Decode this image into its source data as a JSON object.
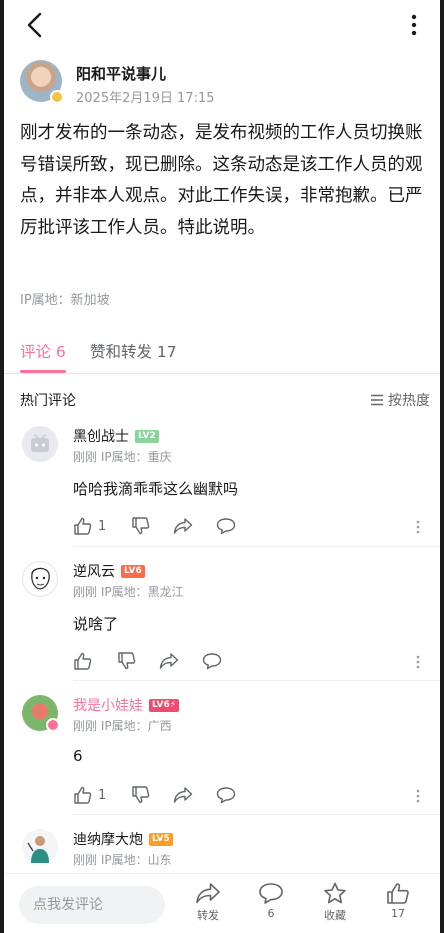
{
  "post": {
    "author_name": "阳和平说事儿",
    "timestamp": "2025年2月19日 17:15",
    "content": "刚才发布的一条动态，是发布视频的工作人员切换账号错误所致，现已删除。这条动态是该工作人员的观点，并非本人观点。对此工作失误，非常抱歉。已严厉批评该工作人员。特此说明。",
    "ip_location": "IP属地：新加坡"
  },
  "tabs": [
    {
      "label": "评论 6",
      "active": true
    },
    {
      "label": "赞和转发 17",
      "active": false
    }
  ],
  "hot": {
    "title": "热门评论",
    "sort_label": "按热度"
  },
  "comments": [
    {
      "name": "黑创战士",
      "level": "LV2",
      "meta": "刚刚  IP属地：重庆",
      "text": "哈哈我滴乖乖这么幽默吗",
      "likes": "1"
    },
    {
      "name": "逆风云",
      "level": "LV6",
      "meta": "刚刚  IP属地：黑龙江",
      "text": "说啥了",
      "likes": ""
    },
    {
      "name": "我是小娃娃",
      "level": "LV6⚡",
      "meta": "刚刚  IP属地：广西",
      "text": "6",
      "likes": "1"
    },
    {
      "name": "迪纳摩大炮",
      "level": "LV5",
      "meta": "刚刚  IP属地：山东"
    }
  ],
  "bottom": {
    "input_placeholder": "点我发评论",
    "forward_label": "转发",
    "comment_count": "6",
    "favorite_label": "收藏",
    "like_count": "17"
  },
  "colors": {
    "accent": "#fb7299",
    "secondary_text": "#9499a0"
  }
}
